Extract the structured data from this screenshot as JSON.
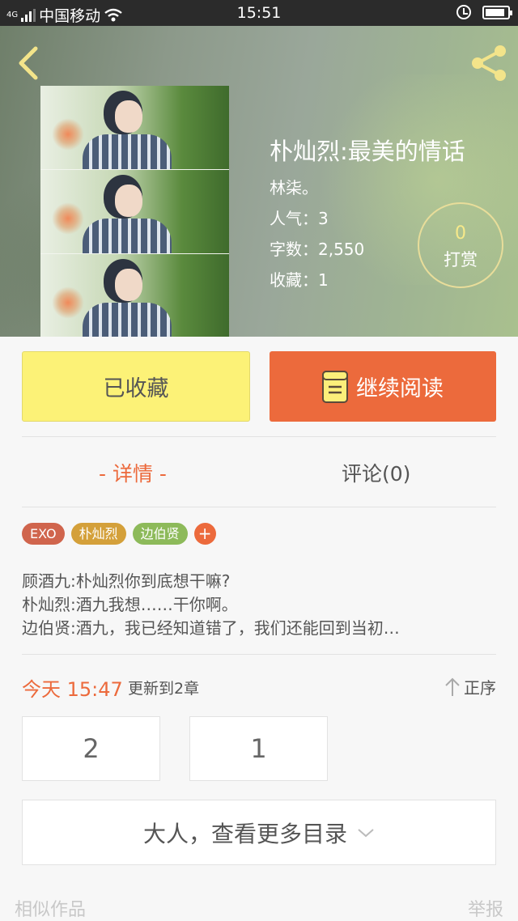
{
  "status_bar": {
    "signal_label": "4G",
    "carrier": "中国移动",
    "time": "15:51",
    "battery_level": 0.9
  },
  "header": {
    "back_icon": "back-arrow-icon",
    "share_icon": "share-icon"
  },
  "book": {
    "title": "朴灿烈:最美的情话",
    "author": "林柒。",
    "popularity": "人气：3",
    "word_count": "字数：2,550",
    "favorites": "收藏：1",
    "reward_count": "0",
    "reward_label": "打赏"
  },
  "actions": {
    "collected_label": "已收藏",
    "read_label": "继续阅读"
  },
  "tabs": {
    "detail": "- 详情 -",
    "comments": "评论(0)"
  },
  "tags": [
    {
      "label": "EXO",
      "color": "#d0654d"
    },
    {
      "label": "朴灿烈",
      "color": "#d4a03a"
    },
    {
      "label": "边伯贤",
      "color": "#8dba5a"
    }
  ],
  "tag_add": "+",
  "synopsis": [
    "顾酒九:朴灿烈你到底想干嘛?",
    "朴灿烈:酒九我想……干你啊。",
    "边伯贤:酒九，我已经知道错了，我们还能回到当初…"
  ],
  "update": {
    "today": "今天 15:47",
    "text": "更新到2章",
    "sort_label": "正序"
  },
  "chapters": [
    "2",
    "1"
  ],
  "more_toc": "大人，查看更多目录",
  "footer": {
    "similar": "相似作品",
    "report": "举报"
  },
  "colors": {
    "accent": "#ec6a3c",
    "collected_bg": "#fcf277"
  }
}
